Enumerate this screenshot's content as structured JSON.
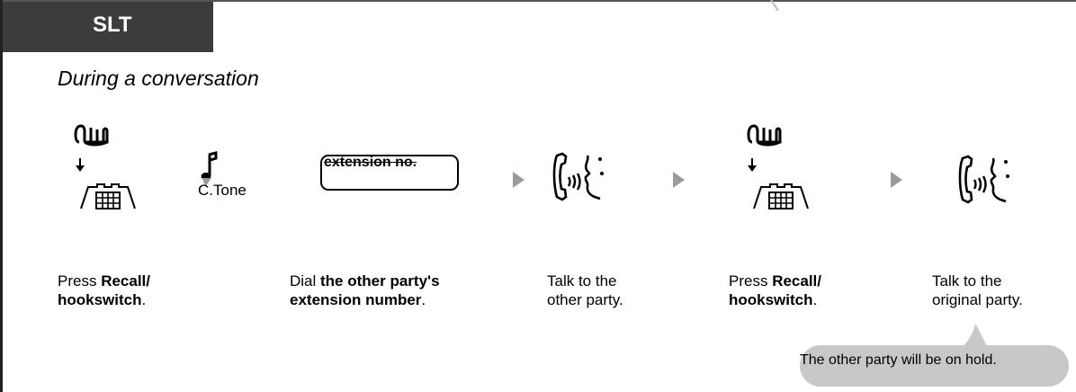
{
  "header": {
    "tab_label": "SLT"
  },
  "subtitle": "During a conversation",
  "steps": [
    {
      "prefix": "Press ",
      "bold1": "Recall/",
      "bold2": "hookswitch",
      "suffix": "."
    },
    {
      "prefix": "Dial ",
      "bold1": "the other party's",
      "bold2": "extension number",
      "suffix": "."
    },
    {
      "line1": "Talk to the",
      "line2": "other party."
    },
    {
      "prefix": "Press ",
      "bold1": "Recall/",
      "bold2": "hookswitch",
      "suffix": "."
    },
    {
      "line1": "Talk to the",
      "line2": "original party."
    }
  ],
  "dial_box_label": "extension no.",
  "tone_label": "C.Tone",
  "note": "The other party will be on hold.",
  "icons": [
    "hand-press-icon",
    "hookswitch-icon",
    "music-note-icon",
    "handset-talk-icon",
    "arrow-right-icon"
  ],
  "colors": {
    "header_bg": "#3c3c3c",
    "arrow": "#9b9b9b",
    "note_bg": "#c8c8c8"
  }
}
